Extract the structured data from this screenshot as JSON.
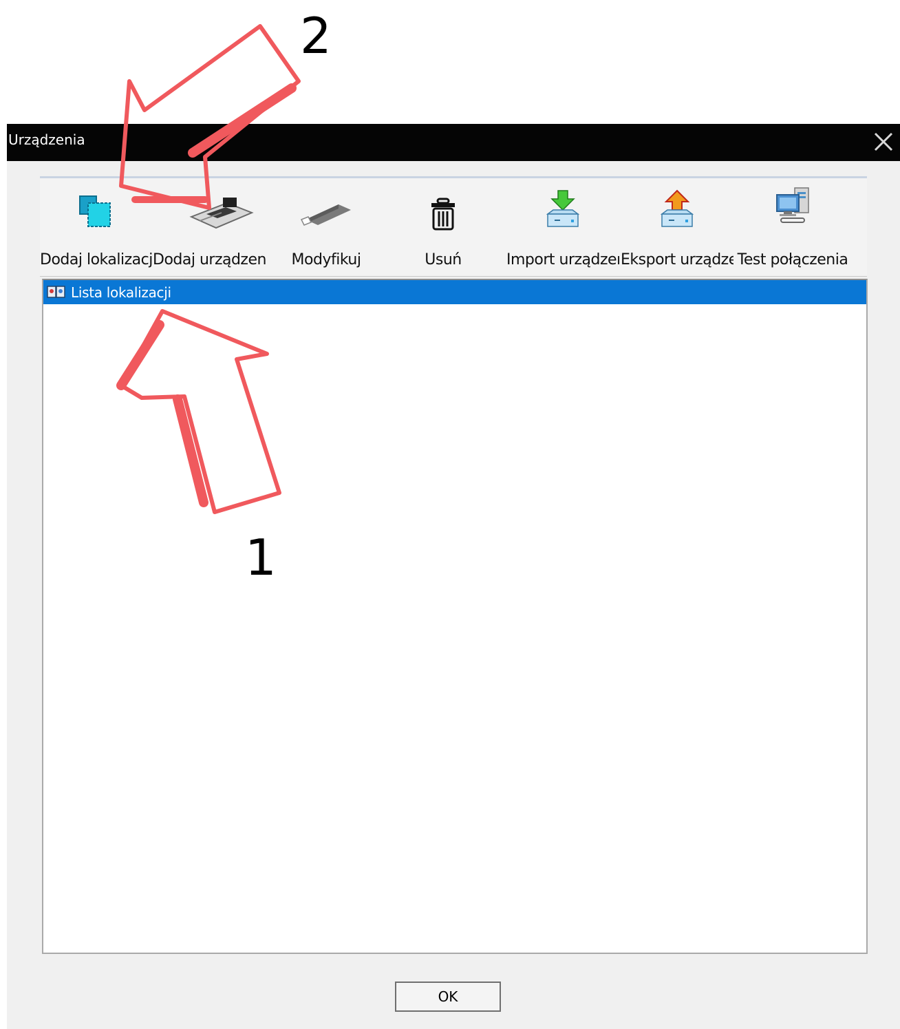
{
  "window": {
    "title": "Urządzenia",
    "close_glyph": "✕"
  },
  "toolbar": {
    "buttons": [
      {
        "label": "Dodaj lokalizację",
        "icon": "add-location-icon"
      },
      {
        "label": "Dodaj urządzenie",
        "icon": "add-device-icon"
      },
      {
        "label": "Modyfikuj",
        "icon": "modify-icon"
      },
      {
        "label": "Usuń",
        "icon": "trash-icon"
      },
      {
        "label": "Import urządzeń",
        "icon": "import-icon"
      },
      {
        "label": "Eksport urządzeń",
        "icon": "export-icon"
      },
      {
        "label": "Test połączenia",
        "icon": "connection-test-icon"
      }
    ]
  },
  "tree": {
    "root_label": "Lista lokalizacji",
    "root_icon": "location-list-icon"
  },
  "footer": {
    "ok_label": "OK"
  },
  "annotations": {
    "arrow_1_label": "1",
    "arrow_2_label": "2",
    "color": "#f0595d"
  },
  "colors": {
    "titlebar": "#050505",
    "selection": "#0a77d5",
    "dialog_bg": "#f0f0f0"
  }
}
